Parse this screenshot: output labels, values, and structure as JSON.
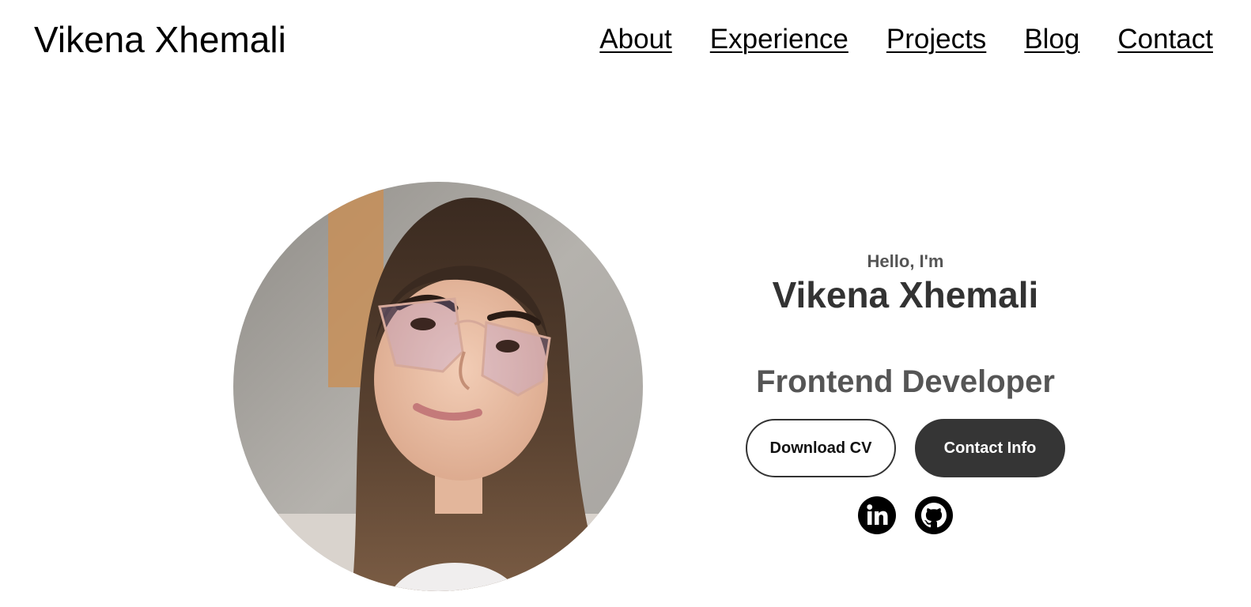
{
  "header": {
    "logo": "Vikena Xhemali",
    "nav": [
      "About",
      "Experience",
      "Projects",
      "Blog",
      "Contact"
    ]
  },
  "profile": {
    "photo_alt": "profile picture",
    "greeting": "Hello, I'm",
    "name": "Vikena Xhemali",
    "role": "Frontend Developer"
  },
  "buttons": {
    "download_cv": "Download CV",
    "contact_info": "Contact Info"
  },
  "socials": [
    {
      "icon": "linkedin-icon"
    },
    {
      "icon": "github-icon"
    }
  ],
  "colors": {
    "dark_button": "#353535",
    "heading": "#333333",
    "subheading": "#555555"
  }
}
